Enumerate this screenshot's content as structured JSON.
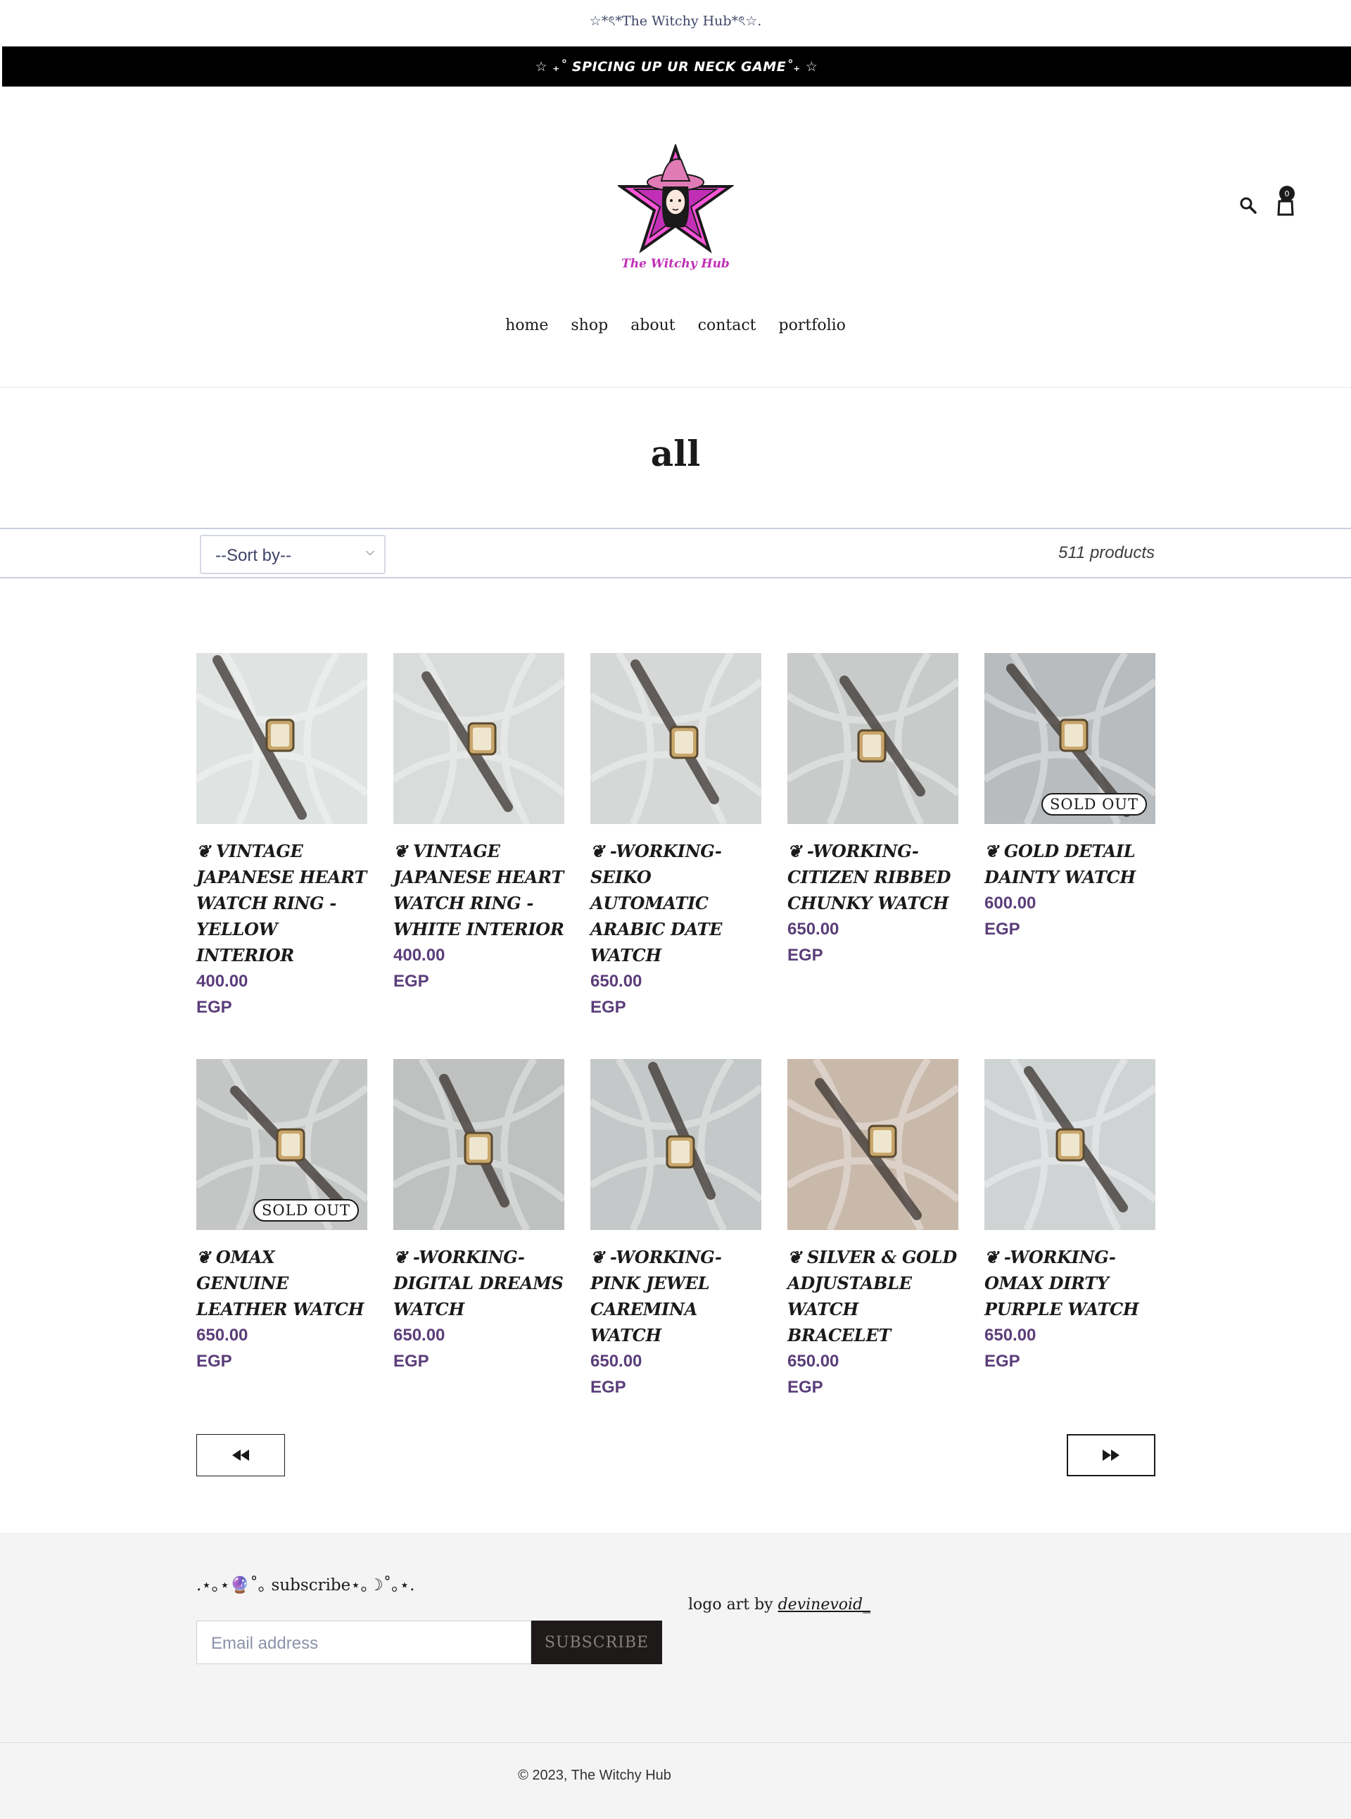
{
  "topbar": {
    "title": "☆*ৎ*The Witchy Hub*ৎ☆."
  },
  "announcement": {
    "text": "☆ ₊˚ SPICING UP UR NECK GAME˚₊ ☆"
  },
  "header": {
    "logo_text": "The Witchy Hub",
    "search_icon": "search-icon",
    "cart_icon": "bag-icon",
    "cart_count": "0"
  },
  "nav": {
    "items": [
      "home",
      "shop",
      "about",
      "contact",
      "portfolio"
    ]
  },
  "collection": {
    "title": "all",
    "sort_label": "--Sort by--",
    "product_count": "511 products"
  },
  "products": [
    {
      "title": "❦ VINTAGE JAPANESE HEART WATCH RING - YELLOW INTERIOR",
      "price": "400.00",
      "currency": "EGP",
      "sold_out": "",
      "bg": "#dfe3e1"
    },
    {
      "title": "❦ VINTAGE JAPANESE HEART WATCH RING - WHITE INTERIOR",
      "price": "400.00",
      "currency": "EGP",
      "sold_out": "",
      "bg": "#d9dcda"
    },
    {
      "title": "❦ -WORKING- SEIKO AUTOMATIC ARABIC DATE WATCH",
      "price": "650.00",
      "currency": "EGP",
      "sold_out": "",
      "bg": "#d6d8d7"
    },
    {
      "title": "❦ -WORKING- CITIZEN RIBBED CHUNKY WATCH",
      "price": "650.00",
      "currency": "EGP",
      "sold_out": "",
      "bg": "#c9cbcb"
    },
    {
      "title": "❦ GOLD DETAIL DAINTY WATCH",
      "price": "600.00",
      "currency": "EGP",
      "sold_out": "SOLD OUT",
      "bg": "#b8bcbe"
    },
    {
      "title": "❦ OMAX GENUINE LEATHER WATCH",
      "price": "650.00",
      "currency": "EGP",
      "sold_out": "SOLD OUT",
      "bg": "#c4c6c6"
    },
    {
      "title": "❦ -WORKING- DIGITAL DREAMS WATCH",
      "price": "650.00",
      "currency": "EGP",
      "sold_out": "",
      "bg": "#bfc1c1"
    },
    {
      "title": "❦ -WORKING- PINK JEWEL CAREMINA WATCH",
      "price": "650.00",
      "currency": "EGP",
      "sold_out": "",
      "bg": "#c5c8c8"
    },
    {
      "title": "❦ SILVER & GOLD ADJUSTABLE WATCH BRACELET",
      "price": "650.00",
      "currency": "EGP",
      "sold_out": "",
      "bg": "#c9b9ab"
    },
    {
      "title": "❦ -WORKING- OMAX DIRTY PURPLE WATCH",
      "price": "650.00",
      "currency": "EGP",
      "sold_out": "",
      "bg": "#cfd3d4"
    }
  ],
  "pagination": {
    "prev_icon": "rewind-icon",
    "next_icon": "fast-forward-icon"
  },
  "footer": {
    "subscribe_heading": ".⋆｡⋆🔮˚｡ subscribe⋆｡☽˚｡⋆.",
    "email_placeholder": "Email address",
    "subscribe_button": "SUBSCRIBE",
    "credit_prefix": "logo art by",
    "credit_link": "devinevoid_",
    "copyright": "© 2023, The Witchy Hub"
  },
  "colors": {
    "accent": "#5b3e7a",
    "announcement_bg": "#000000",
    "footer_bg": "#f4f4f4"
  }
}
